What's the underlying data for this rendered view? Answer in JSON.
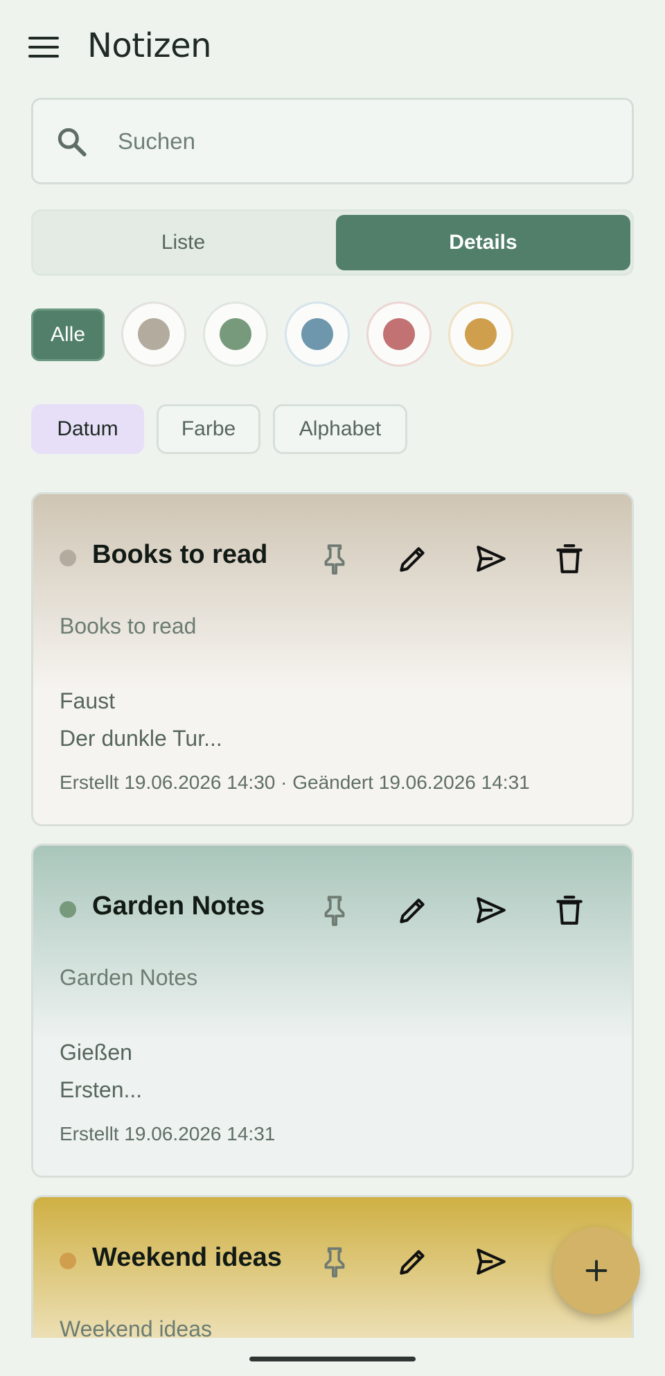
{
  "app": {
    "title": "Notizen"
  },
  "search": {
    "placeholder": "Suchen"
  },
  "view_toggle": {
    "options": [
      "Liste",
      "Details"
    ],
    "selected": "Details"
  },
  "color_filter": {
    "all_label": "Alle",
    "selected": "Alle",
    "colors": [
      {
        "name": "grey",
        "hex": "#b4ab9f",
        "ring": "#e3e1dc"
      },
      {
        "name": "green",
        "hex": "#789a7c",
        "ring": "#dfe6df"
      },
      {
        "name": "blue",
        "hex": "#6e97ae",
        "ring": "#d6e3ea"
      },
      {
        "name": "red",
        "hex": "#c27272",
        "ring": "#ecd6d3"
      },
      {
        "name": "yellow",
        "hex": "#cf9f4e",
        "ring": "#f0e1c4"
      }
    ]
  },
  "sort": {
    "options": [
      "Datum",
      "Farbe",
      "Alphabet"
    ],
    "selected": "Datum"
  },
  "notes": [
    {
      "title": "Books to read",
      "dot_color": "#b4ab9f",
      "gradient": [
        "#cfc5b4",
        "#f6f4f0"
      ],
      "body_lines": [
        "Books to read",
        "",
        "Faust",
        "Der dunkle Tur..."
      ],
      "meta": "Erstellt 19.06.2026 14:30 · Geändert 19.06.2026 14:31"
    },
    {
      "title": "Garden Notes",
      "dot_color": "#789a7c",
      "gradient": [
        "#a9c6bb",
        "#eef2f1"
      ],
      "body_lines": [
        "Garden Notes",
        "",
        "Gießen",
        "Ersten..."
      ],
      "meta": "Erstellt 19.06.2026 14:31"
    },
    {
      "title": "Weekend ideas",
      "dot_color": "#cf9f4e",
      "gradient": [
        "#cfb044",
        "#f7f1df"
      ],
      "body_lines": [
        "Weekend ideas"
      ],
      "meta": ""
    }
  ],
  "icons": {
    "menu": "menu-icon",
    "search": "search-icon",
    "pin": "pin-icon",
    "edit": "pencil-icon",
    "share": "send-icon",
    "delete": "trash-icon",
    "add": "plus-icon"
  }
}
